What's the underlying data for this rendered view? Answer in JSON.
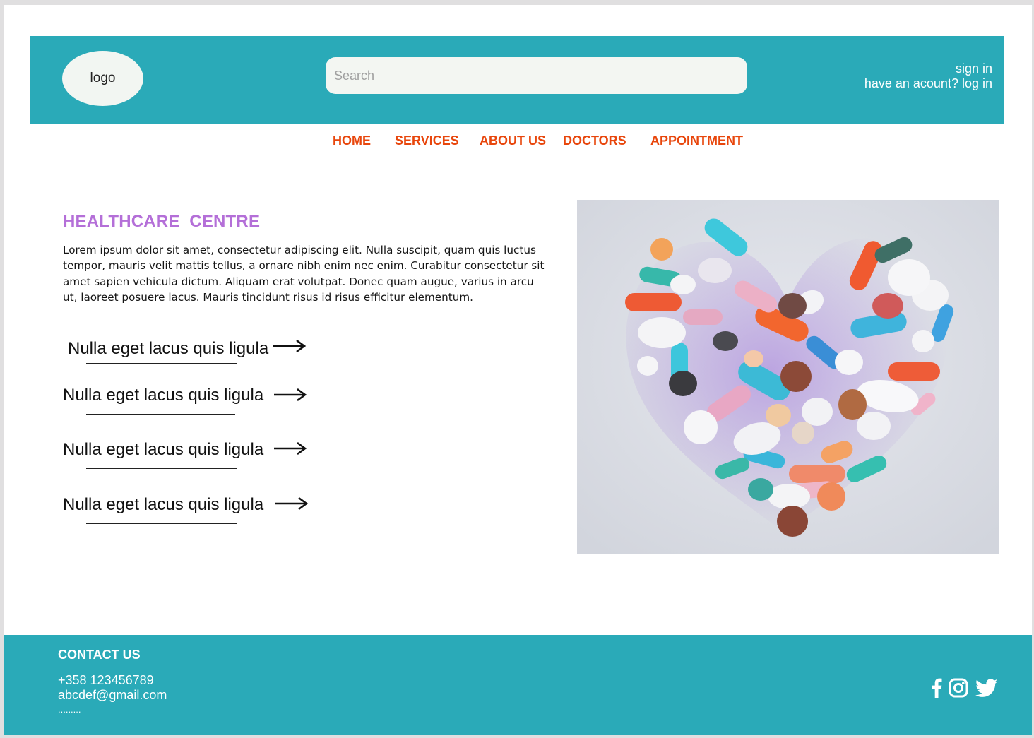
{
  "header": {
    "logo_text": "logo",
    "search_placeholder": "Search",
    "sign_in": "sign in",
    "log_in": "have an acount? log in"
  },
  "nav": {
    "items": [
      "HOME",
      "SERVICES",
      "ABOUT US",
      "DOCTORS",
      "APPOINTMENT"
    ]
  },
  "main": {
    "title": "HEALTHCARE  CENTRE",
    "intro": "Lorem ipsum dolor sit amet, consectetur adipiscing elit. Nulla suscipit, quam quis luctus tempor, mauris velit mattis tellus, a ornare nibh enim nec enim. Curabitur consectetur sit amet sapien vehicula dictum. Aliquam erat volutpat. Donec quam augue, varius in arcu ut, laoreet posuere lacus. Mauris tincidunt risus id risus efficitur elementum.",
    "links": [
      "Nulla eget lacus quis ligula",
      "Nulla eget lacus quis ligula",
      "Nulla eget lacus quis ligula",
      "Nulla eget lacus quis ligula"
    ]
  },
  "footer": {
    "title": "CONTACT US",
    "phone": "+358 123456789",
    "email": "abcdef@gmail.com",
    "more": "........."
  },
  "icons": [
    "arrow-right-icon",
    "facebook-icon",
    "instagram-icon",
    "twitter-icon"
  ],
  "colors": {
    "brand": "#2aaab8",
    "nav": "#e8460c",
    "title": "#b46fd8"
  }
}
